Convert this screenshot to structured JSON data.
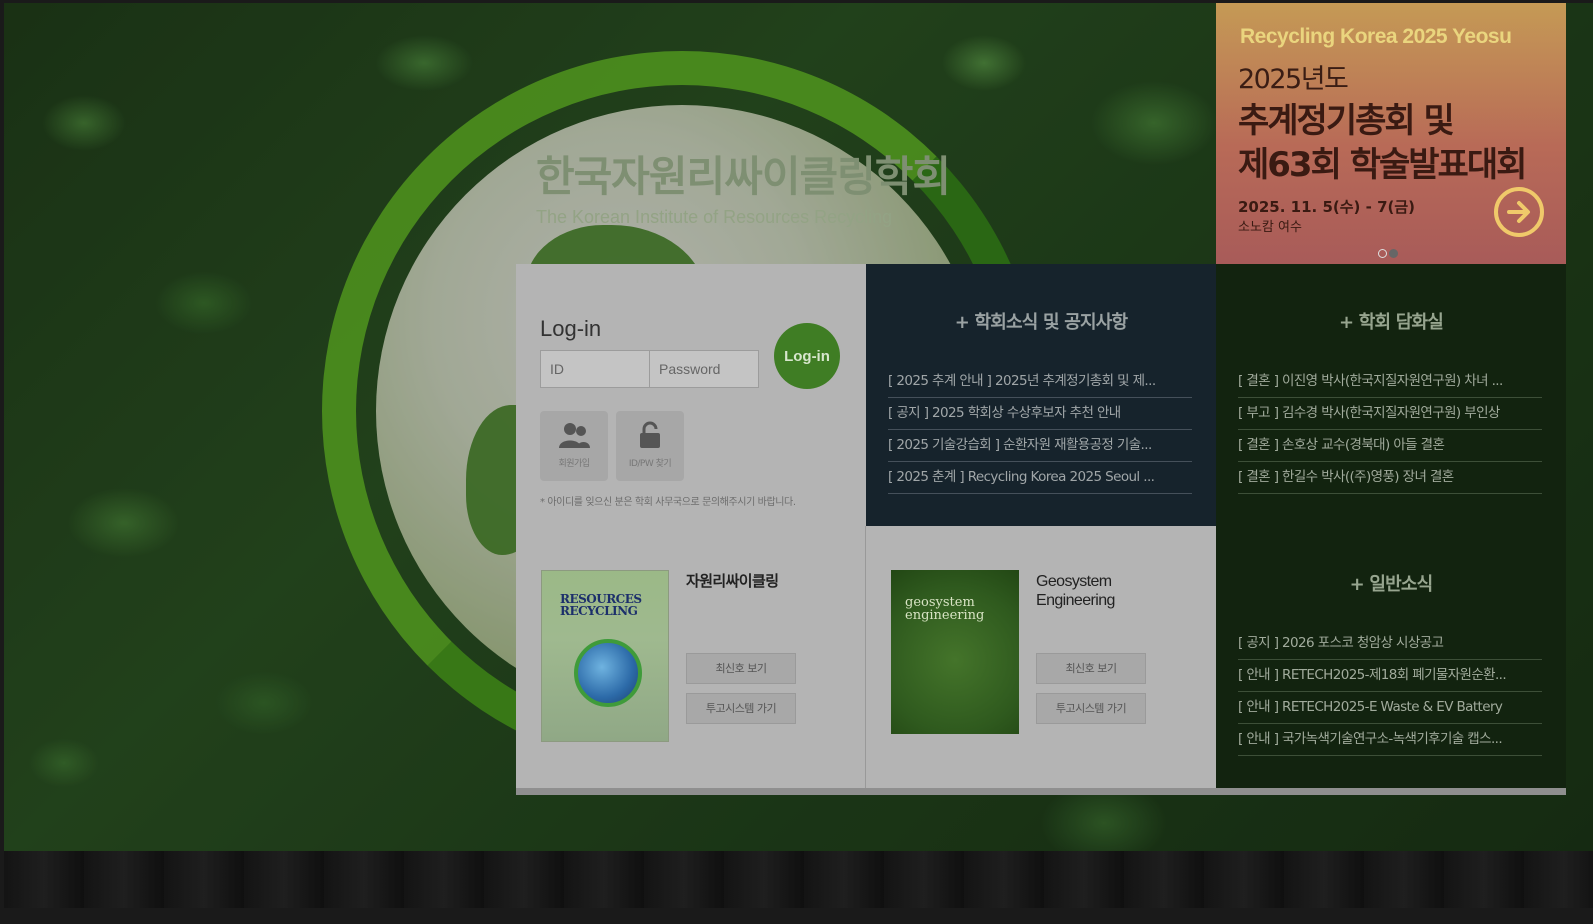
{
  "site": {
    "title": "한국자원리싸이클링학회",
    "subtitle": "The Korean Institute of Resources Recycling"
  },
  "banner": {
    "tagline": "Recycling Korea 2025 Yeosu",
    "year_line": "2025년도",
    "line1": "추계정기총회 및",
    "line2": "제63회 학술발표대회",
    "date": "2025. 11. 5(수) - 7(금)",
    "place": "소노캄 여수",
    "slides_total": 2,
    "active_slide": 2,
    "colors": {
      "accent": "#f0c96a",
      "text": "#3a1a12"
    }
  },
  "login": {
    "title": "Log-in",
    "id_placeholder": "ID",
    "password_placeholder": "Password",
    "button_label": "Log-in",
    "join_label": "회원가입",
    "find_label": "ID/PW 찾기",
    "note": "* 아이디를 잊으신 분은 학회 사무국으로 문의해주시기 바랍니다."
  },
  "news": {
    "title": "+ 학회소식 및 공지사항",
    "items": [
      "[ 2025 추계 안내 ] 2025년 추계정기총회 및 제...",
      "[ 공지 ] 2025 학회상 수상후보자 추천 안내",
      "[ 2025 기술강습회 ] 순환자원 재활용공정 기술...",
      "[ 2025 춘계 ] Recycling Korea 2025 Seoul ..."
    ]
  },
  "discuss": {
    "title": "+ 학회 담화실",
    "items": [
      "[ 결혼 ] 이진영 박사(한국지질자원연구원) 차녀 ...",
      "[ 부고 ] 김수경 박사(한국지질자원연구원) 부인상",
      "[ 결혼 ] 손호상 교수(경북대) 아들 결혼",
      "[ 결혼 ] 한길수 박사((주)영풍) 장녀 결혼"
    ]
  },
  "general": {
    "title": "+ 일반소식",
    "items": [
      "[ 공지 ] 2026 포스코 청암상 시상공고",
      "[ 안내 ] RETECH2025-제18회 폐기물자원순환...",
      "[ 안내 ] RETECH2025-E Waste & EV Battery",
      "[ 안내 ] 국가녹색기술연구소-녹색기후기술 캡스..."
    ]
  },
  "journals": [
    {
      "name": "자원리싸이클링",
      "cover_title": "RESOURCES RECYCLING",
      "latest_label": "최신호 보기",
      "submit_label": "투고시스템 가기"
    },
    {
      "name_line1": "Geosystem",
      "name_line2": "Engineering",
      "cover_title": "geosystem engineering",
      "latest_label": "최신호 보기",
      "submit_label": "투고시스템 가기"
    }
  ]
}
